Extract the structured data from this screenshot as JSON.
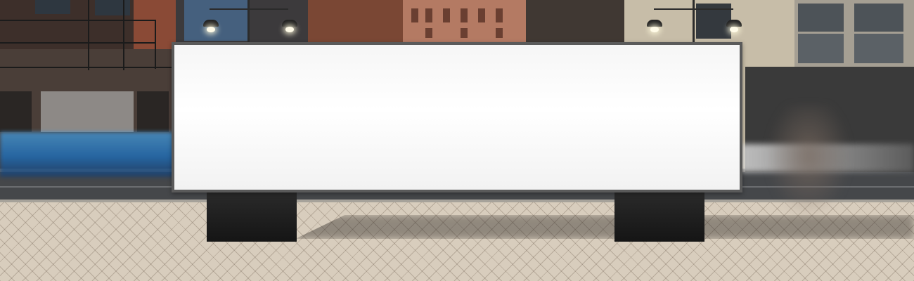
{
  "scene": {
    "subject": "blank billboard",
    "colors": {
      "billboard_face": "#ffffff",
      "billboard_frame": "#5a5a5a",
      "billboard_legs": "#1a1a1a",
      "sidewalk": "#d8cdbd",
      "street": "#45474a",
      "car_blur": "#2a7ac0"
    },
    "icons": [
      "street-lamp",
      "fire-escape"
    ]
  }
}
